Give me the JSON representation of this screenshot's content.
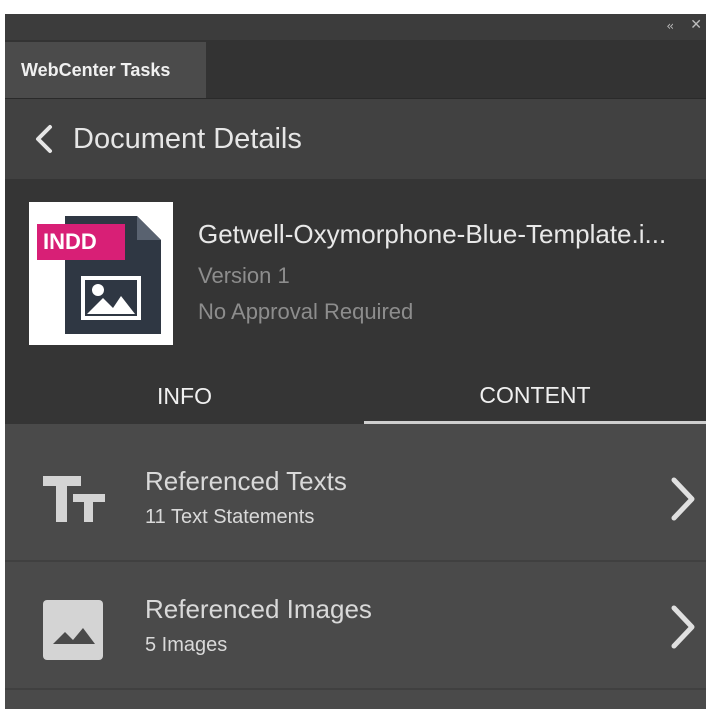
{
  "panel": {
    "collapse_glyph": "‹‹",
    "close_glyph": "✕"
  },
  "tab": {
    "label": "WebCenter Tasks"
  },
  "header": {
    "title": "Document Details",
    "back_icon": "chevron-left-icon"
  },
  "document": {
    "badge": "INDD",
    "name": "Getwell-Oxymorphone-Blue-Template.i...",
    "version": "Version 1",
    "approval": "No Approval Required"
  },
  "detail_tabs": {
    "info": "INFO",
    "content": "CONTENT",
    "active": "content"
  },
  "items": [
    {
      "title": "Referenced Texts",
      "subtitle": "11 Text Statements",
      "icon": "text-size-icon"
    },
    {
      "title": "Referenced Images",
      "subtitle": "5 Images",
      "icon": "image-icon"
    }
  ],
  "colors": {
    "panel_bg": "#3a3a3a",
    "badge": "#d81f76",
    "text_primary": "#e6e6e6",
    "text_muted": "#8d8d8d"
  }
}
